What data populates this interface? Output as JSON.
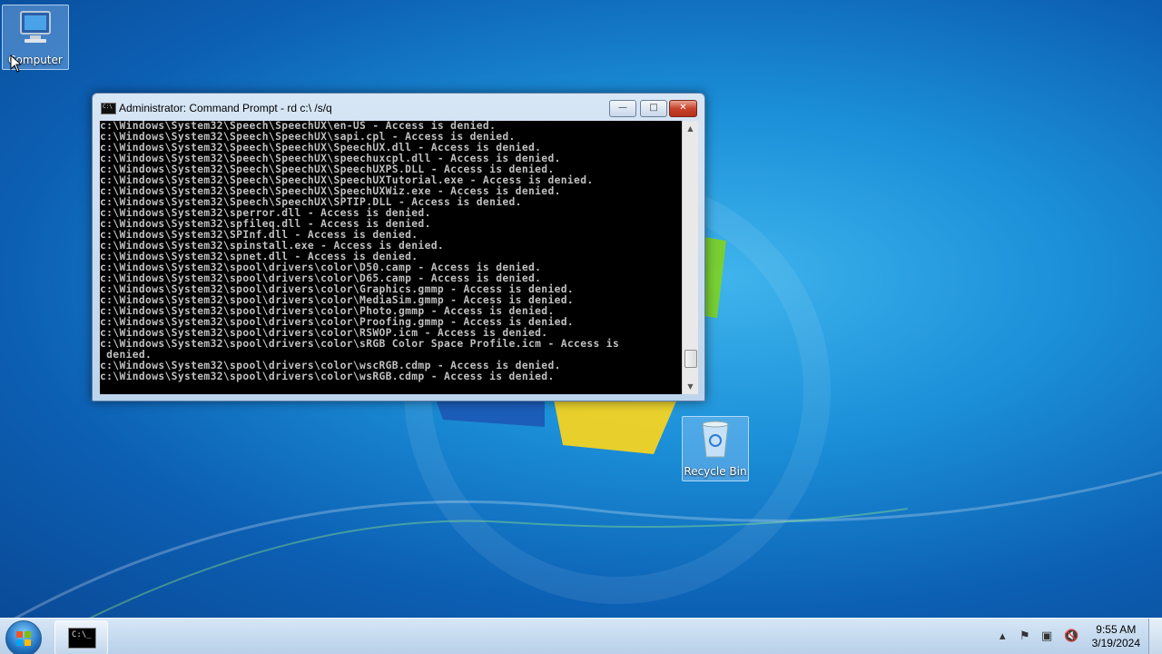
{
  "desktop": {
    "icons": [
      {
        "label": "Computer"
      },
      {
        "label": "Recycle Bin"
      }
    ]
  },
  "cmd_window": {
    "title": "Administrator:  Command Prompt - rd  c:\\ /s/q",
    "buttons": {
      "minimize": "—",
      "maximize": "□",
      "close": "✕"
    },
    "lines": [
      "c:\\Windows\\System32\\Speech\\SpeechUX\\en-US - Access is denied.",
      "c:\\Windows\\System32\\Speech\\SpeechUX\\sapi.cpl - Access is denied.",
      "c:\\Windows\\System32\\Speech\\SpeechUX\\SpeechUX.dll - Access is denied.",
      "c:\\Windows\\System32\\Speech\\SpeechUX\\speechuxcpl.dll - Access is denied.",
      "c:\\Windows\\System32\\Speech\\SpeechUX\\SpeechUXPS.DLL - Access is denied.",
      "c:\\Windows\\System32\\Speech\\SpeechUX\\SpeechUXTutorial.exe - Access is denied.",
      "c:\\Windows\\System32\\Speech\\SpeechUX\\SpeechUXWiz.exe - Access is denied.",
      "c:\\Windows\\System32\\Speech\\SpeechUX\\SPTIP.DLL - Access is denied.",
      "c:\\Windows\\System32\\sperror.dll - Access is denied.",
      "c:\\Windows\\System32\\spfileq.dll - Access is denied.",
      "c:\\Windows\\System32\\SPInf.dll - Access is denied.",
      "c:\\Windows\\System32\\spinstall.exe - Access is denied.",
      "c:\\Windows\\System32\\spnet.dll - Access is denied.",
      "c:\\Windows\\System32\\spool\\drivers\\color\\D50.camp - Access is denied.",
      "c:\\Windows\\System32\\spool\\drivers\\color\\D65.camp - Access is denied.",
      "c:\\Windows\\System32\\spool\\drivers\\color\\Graphics.gmmp - Access is denied.",
      "c:\\Windows\\System32\\spool\\drivers\\color\\MediaSim.gmmp - Access is denied.",
      "c:\\Windows\\System32\\spool\\drivers\\color\\Photo.gmmp - Access is denied.",
      "c:\\Windows\\System32\\spool\\drivers\\color\\Proofing.gmmp - Access is denied.",
      "c:\\Windows\\System32\\spool\\drivers\\color\\RSWOP.icm - Access is denied.",
      "c:\\Windows\\System32\\spool\\drivers\\color\\sRGB Color Space Profile.icm - Access is",
      " denied.",
      "c:\\Windows\\System32\\spool\\drivers\\color\\wscRGB.cdmp - Access is denied.",
      "c:\\Windows\\System32\\spool\\drivers\\color\\wsRGB.cdmp - Access is denied."
    ],
    "scroll_fraction": 0.95
  },
  "taskbar": {
    "time": "9:55 AM",
    "date": "3/19/2024",
    "tray_icons": [
      "chevron-up-icon",
      "flag-icon",
      "network-icon",
      "speaker-muted-icon"
    ]
  },
  "colors": {
    "console_bg": "#000000",
    "console_fg": "#c0c0c0",
    "desktop_accent": "#1b8fd8"
  }
}
